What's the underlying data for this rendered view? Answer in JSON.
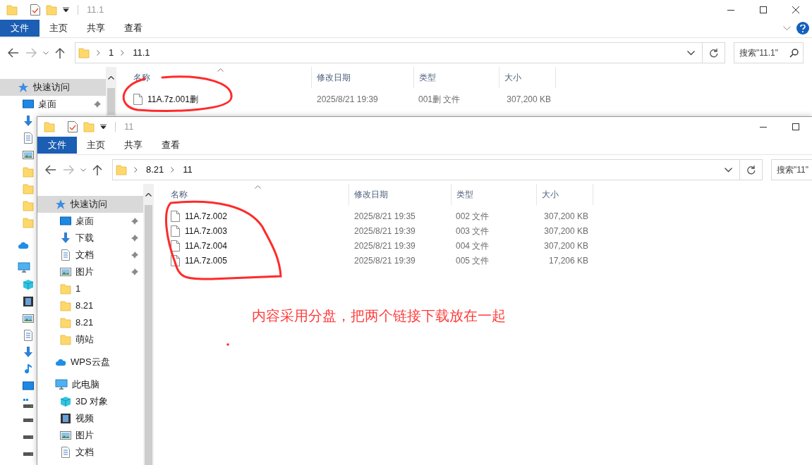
{
  "back_window": {
    "title": "11.1",
    "controls": [
      {
        "kind": "minimize"
      },
      {
        "kind": "maximize"
      },
      {
        "kind": "close"
      }
    ],
    "help_button": true,
    "ribbon": {
      "file_menu": "文件",
      "tabs": [
        "主页",
        "共享",
        "查看"
      ]
    },
    "path": [
      "1",
      "11.1"
    ],
    "search": {
      "placeholder": "搜索\"11.1\""
    },
    "sidebar": {
      "items": [
        {
          "label": "快速访问",
          "kind": "quickaccess",
          "selected": true,
          "children": [
            {
              "label": "桌面",
              "kind": "desktop",
              "pinned": true
            },
            {
              "kind": "downloads"
            },
            {
              "kind": "documents"
            },
            {
              "kind": "pictures"
            },
            {
              "kind": "folder"
            },
            {
              "kind": "folder"
            },
            {
              "kind": "folder"
            },
            {
              "kind": "folder"
            }
          ]
        },
        {
          "kind": "cloud"
        },
        {
          "kind": "pc",
          "children": [
            {
              "kind": "objects"
            },
            {
              "kind": "video"
            },
            {
              "kind": "pictures"
            },
            {
              "kind": "documents"
            },
            {
              "kind": "downloads"
            },
            {
              "kind": "music"
            },
            {
              "kind": "desktop"
            },
            {
              "kind": "systemdrive"
            },
            {
              "kind": "drive"
            },
            {
              "kind": "drive"
            },
            {
              "kind": "drive"
            }
          ]
        }
      ]
    },
    "columns": [
      "名称",
      "修改日期",
      "类型",
      "大小"
    ],
    "rows": [
      {
        "name": "11A.7z.001删",
        "modified": "2025/8/21 19:39",
        "type": "001删 文件",
        "size": "307,200 KB"
      }
    ]
  },
  "front_window": {
    "title": "11",
    "controls": [
      {
        "kind": "minimize"
      },
      {
        "kind": "maximize"
      }
    ],
    "ribbon": {
      "file_menu": "文件",
      "tabs": [
        "主页",
        "共享",
        "查看"
      ]
    },
    "path": [
      "8.21",
      "11"
    ],
    "search": {
      "placeholder": "搜索\"11\""
    },
    "sidebar": {
      "items": [
        {
          "label": "快速访问",
          "kind": "quickaccess",
          "selected": true,
          "children": [
            {
              "label": "桌面",
              "kind": "desktop",
              "pinned": true,
              "selected": false
            },
            {
              "label": "下载",
              "kind": "downloads",
              "pinned": true,
              "selected": false
            },
            {
              "label": "文档",
              "kind": "documents",
              "pinned": true,
              "selected": false
            },
            {
              "label": "图片",
              "kind": "pictures",
              "pinned": true,
              "selected": false
            },
            {
              "label": "1",
              "kind": "folder",
              "pinned": false,
              "selected": false
            },
            {
              "label": "8.21",
              "kind": "folder",
              "pinned": false,
              "selected": false
            },
            {
              "label": "8.21",
              "kind": "folder",
              "pinned": false,
              "selected": false
            },
            {
              "label": "萌站",
              "kind": "folder",
              "pinned": false,
              "selected": false
            }
          ]
        },
        {
          "label": "WPS云盘",
          "kind": "cloud",
          "selected": false
        },
        {
          "label": "此电脑",
          "kind": "pc",
          "selected": false,
          "children": [
            {
              "label": "3D 对象",
              "kind": "objects",
              "selected": false
            },
            {
              "label": "视频",
              "kind": "video",
              "selected": false
            },
            {
              "label": "图片",
              "kind": "pictures",
              "selected": false
            },
            {
              "label": "文档",
              "kind": "documents",
              "selected": false
            }
          ]
        }
      ]
    },
    "columns": [
      "名称",
      "修改日期",
      "类型",
      "大小"
    ],
    "rows": [
      {
        "name": "11A.7z.002",
        "modified": "2025/8/21 19:35",
        "type": "002 文件",
        "size": "307,200 KB"
      },
      {
        "name": "11A.7z.003",
        "modified": "2025/8/21 19:39",
        "type": "003 文件",
        "size": "307,200 KB"
      },
      {
        "name": "11A.7z.004",
        "modified": "2025/8/21 19:39",
        "type": "004 文件",
        "size": "307,200 KB"
      },
      {
        "name": "11A.7z.005",
        "modified": "2025/8/21 19:39",
        "type": "005 文件",
        "size": "17,206 KB"
      }
    ]
  },
  "annotations": [
    {
      "kind": "note",
      "text": "内容采用分盘，把两个链接下载放在一起"
    }
  ]
}
